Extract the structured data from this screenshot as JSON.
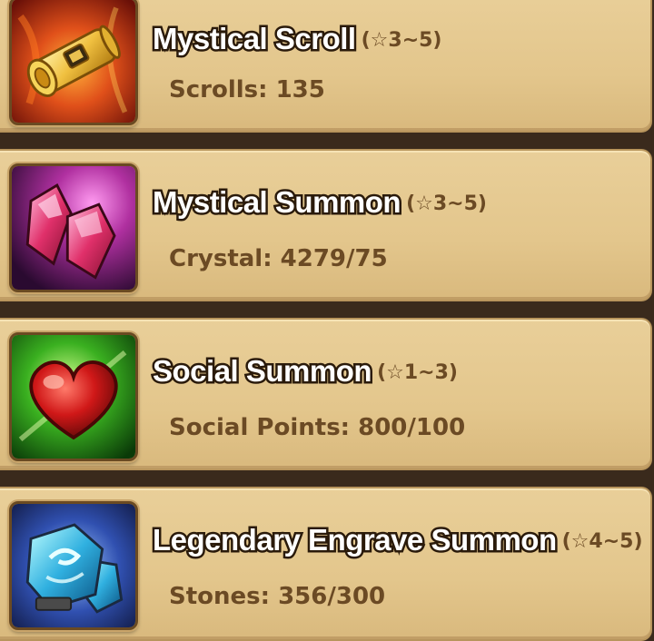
{
  "summons": [
    {
      "name": "Mystical Scroll",
      "stars": "(☆3~5)",
      "resource": "Scrolls: 135",
      "icon": "mystical-scroll-icon"
    },
    {
      "name": "Mystical Summon",
      "stars": "(☆3~5)",
      "resource": "Crystal: 4279/75",
      "icon": "crystal-icon"
    },
    {
      "name": "Social Summon",
      "stars": "(☆1~3)",
      "resource": "Social Points: 800/100",
      "icon": "heart-icon"
    },
    {
      "name": "Legendary Engrave Summon",
      "stars": "(☆4~5)",
      "resource": "Stones: 356/300",
      "icon": "engrave-stone-icon"
    }
  ]
}
